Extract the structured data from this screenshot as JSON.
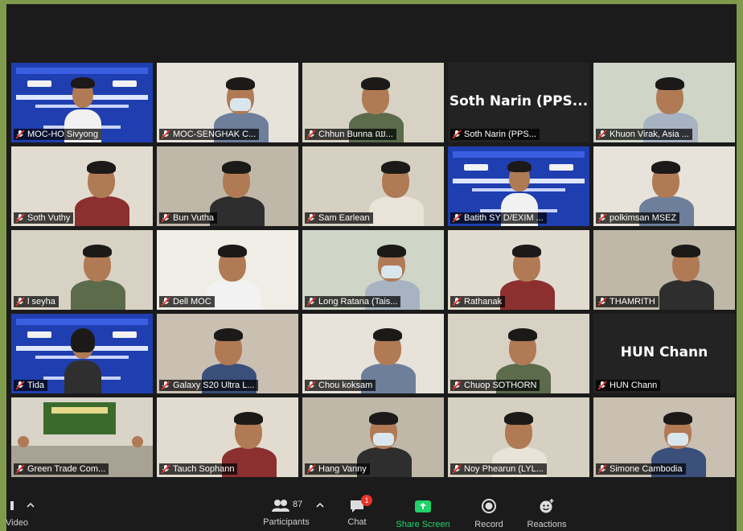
{
  "participants": [
    {
      "name": "MOC-HO Sivyong",
      "kind": "banner"
    },
    {
      "name": "MOC-SENGHAK C...",
      "kind": "person"
    },
    {
      "name": "Chhun Bunna ឈ...",
      "kind": "person"
    },
    {
      "name": "Soth Narin (PPS...",
      "kind": "nameonly",
      "display": "Soth Narin (PPS..."
    },
    {
      "name": "Khuon Virak, Asia ...",
      "kind": "person"
    },
    {
      "name": "Soth Vuthy",
      "kind": "person"
    },
    {
      "name": "Bun Vutha",
      "kind": "person"
    },
    {
      "name": "Sam Earlean",
      "kind": "person"
    },
    {
      "name": "Batith SY D/EXIM ...",
      "kind": "banner"
    },
    {
      "name": "polkimsan MSEZ",
      "kind": "person"
    },
    {
      "name": "l seyha",
      "kind": "person"
    },
    {
      "name": "Dell MOC",
      "kind": "person"
    },
    {
      "name": "Long Ratana (Tais...",
      "kind": "person"
    },
    {
      "name": "Rathanak",
      "kind": "person"
    },
    {
      "name": "THAMRITH",
      "kind": "person"
    },
    {
      "name": "Tida",
      "kind": "banner",
      "active": true
    },
    {
      "name": "Galaxy S20 Ultra L...",
      "kind": "person"
    },
    {
      "name": "Chou koksam",
      "kind": "person"
    },
    {
      "name": "Chuop SOTHORN",
      "kind": "person"
    },
    {
      "name": "HUN Chann",
      "kind": "nameonly",
      "display": "HUN Chann"
    },
    {
      "name": "Green Trade Com...",
      "kind": "room"
    },
    {
      "name": "Tauch Sophann",
      "kind": "person"
    },
    {
      "name": "Hang Vanny",
      "kind": "person"
    },
    {
      "name": "Noy Phearun (LYL...",
      "kind": "person"
    },
    {
      "name": "Simone Cambodia",
      "kind": "person"
    }
  ],
  "toolbar": {
    "video_label": "Video",
    "participants_label": "Participants",
    "participants_count": "87",
    "chat_label": "Chat",
    "chat_badge": "1",
    "share_label": "Share Screen",
    "record_label": "Record",
    "reactions_label": "Reactions"
  },
  "colors": {
    "share_green": "#1fd36a",
    "active_border": "#d7e84a",
    "badge_red": "#e8332a"
  }
}
